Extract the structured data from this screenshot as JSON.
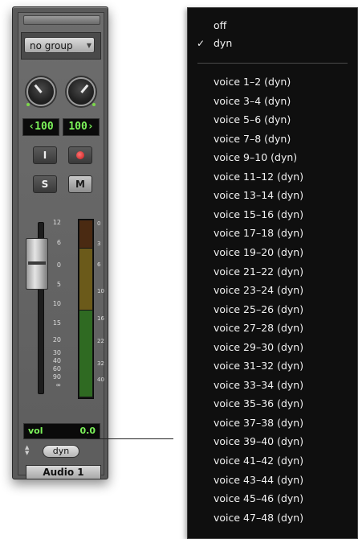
{
  "strip": {
    "group": "no group",
    "pan_left": "‹100",
    "pan_right": "100›",
    "input_btn": "I",
    "solo_btn": "S",
    "mute_btn": "M",
    "fader_scale": [
      "12",
      "6",
      "0",
      "5",
      "10",
      "15",
      "20",
      "30",
      "40",
      "60",
      "90",
      "∞"
    ],
    "meter_scale": [
      "0",
      "3",
      "6",
      "10",
      "16",
      "22",
      "32",
      "40"
    ],
    "vol_label": "vol",
    "vol_value": "0.0",
    "voice_btn": "dyn",
    "track_name": "Audio 1"
  },
  "menu": {
    "top_items": [
      {
        "label": "off",
        "checked": false
      },
      {
        "label": "dyn",
        "checked": true
      }
    ],
    "check_glyph": "✓",
    "voice_items": [
      "voice 1–2 (dyn)",
      "voice 3–4 (dyn)",
      "voice 5–6 (dyn)",
      "voice 7–8 (dyn)",
      "voice 9–10 (dyn)",
      "voice 11–12 (dyn)",
      "voice 13–14 (dyn)",
      "voice 15–16 (dyn)",
      "voice 17–18 (dyn)",
      "voice 19–20 (dyn)",
      "voice 21–22 (dyn)",
      "voice 23–24 (dyn)",
      "voice 25–26 (dyn)",
      "voice 27–28 (dyn)",
      "voice 29–30 (dyn)",
      "voice 31–32 (dyn)",
      "voice 33–34 (dyn)",
      "voice 35–36 (dyn)",
      "voice 37–38 (dyn)",
      "voice 39–40 (dyn)",
      "voice 41–42 (dyn)",
      "voice 43–44 (dyn)",
      "voice 45–46 (dyn)",
      "voice 47–48 (dyn)"
    ]
  }
}
